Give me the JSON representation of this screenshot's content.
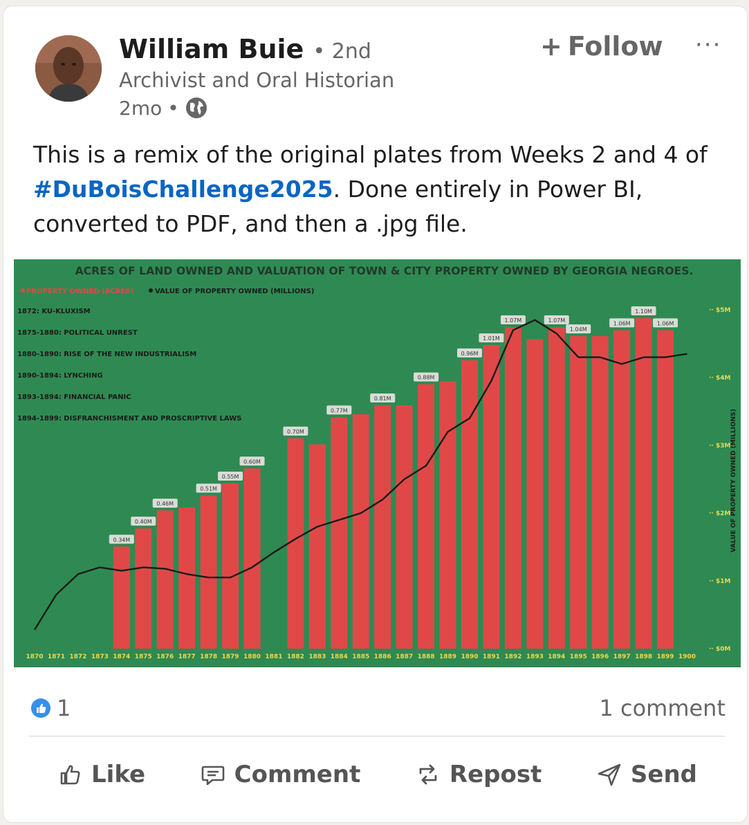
{
  "author": {
    "name": "William Buie",
    "degree": "2nd",
    "headline": "Archivist and Oral Historian",
    "time": "2mo"
  },
  "follow_label": "Follow",
  "more_label": "···",
  "post": {
    "text_before": "This is a remix of the original plates from Weeks 2 and 4 of ",
    "hashtag": "#DuBoisChallenge2025",
    "text_after": ". Done entirely in Power BI, converted to PDF, and then a .jpg file."
  },
  "reaction_count": "1",
  "comment_count": "1 comment",
  "actions": {
    "like": "Like",
    "comment": "Comment",
    "repost": "Repost",
    "send": "Send"
  },
  "colors": {
    "chart_bg": "#2e8a52",
    "bar": "#e04848",
    "title": "#1f3a28",
    "axis_text": "#f0d84a",
    "link": "#0a66c2"
  },
  "chart_data": {
    "type": "bar",
    "title": "ACRES OF LAND OWNED AND VALUATION OF TOWN & CITY PROPERTY OWNED BY GEORGIA NEGROES.",
    "legend": [
      "PROPERTY OWNED (ACRES)",
      "VALUE OF PROPERTY OWNED (MILLIONS)"
    ],
    "annotations": [
      "1872: KU-KLUXISM",
      "1875-1880: POLITICAL UNREST",
      "1880-1890: RISE OF THE NEW INDUSTRIALISM",
      "1890-1894: LYNCHING",
      "1893-1894: FINANCIAL PANIC",
      "1894-1899: DISFRANCHISMENT AND PROSCRIPTIVE LAWS"
    ],
    "categories": [
      "1870",
      "1871",
      "1872",
      "1873",
      "1874",
      "1875",
      "1876",
      "1877",
      "1878",
      "1879",
      "1880",
      "1881",
      "1882",
      "1883",
      "1884",
      "1885",
      "1886",
      "1887",
      "1888",
      "1889",
      "1890",
      "1891",
      "1892",
      "1893",
      "1894",
      "1895",
      "1896",
      "1897",
      "1898",
      "1899",
      "1900"
    ],
    "bars": [
      null,
      null,
      null,
      null,
      0.34,
      0.4,
      0.46,
      0.47,
      0.51,
      0.55,
      0.6,
      null,
      0.7,
      0.68,
      0.77,
      0.78,
      0.81,
      0.81,
      0.88,
      0.89,
      0.96,
      1.01,
      1.07,
      1.03,
      1.07,
      1.04,
      1.04,
      1.06,
      1.1,
      1.06,
      null
    ],
    "bar_labels": [
      "",
      "",
      "",
      "",
      "0.34M",
      "0.40M",
      "0.46M",
      "",
      "0.51M",
      "0.55M",
      "0.60M",
      "",
      "0.70M",
      "",
      "0.77M",
      "",
      "0.81M",
      "",
      "0.88M",
      "",
      "0.96M",
      "1.01M",
      "1.07M",
      "",
      "1.07M",
      "1.04M",
      "",
      "1.06M",
      "1.10M",
      "1.06M",
      ""
    ],
    "bar_max": 1.1,
    "line_values": [
      0.28,
      0.8,
      1.1,
      1.2,
      1.15,
      1.2,
      1.18,
      1.1,
      1.05,
      1.05,
      1.2,
      1.42,
      1.62,
      1.8,
      1.9,
      2.0,
      2.2,
      2.5,
      2.7,
      3.2,
      3.4,
      3.95,
      4.7,
      4.85,
      4.65,
      4.3,
      4.3,
      4.2,
      4.3,
      4.3,
      4.35
    ],
    "y_right_ticks": [
      "$0M",
      "$1M",
      "$2M",
      "$3M",
      "$4M",
      "$5M"
    ],
    "y_right_range": [
      0,
      5
    ],
    "y_right_label": "VALUE OF PROPERTY OWNED (MILLIONS)"
  }
}
